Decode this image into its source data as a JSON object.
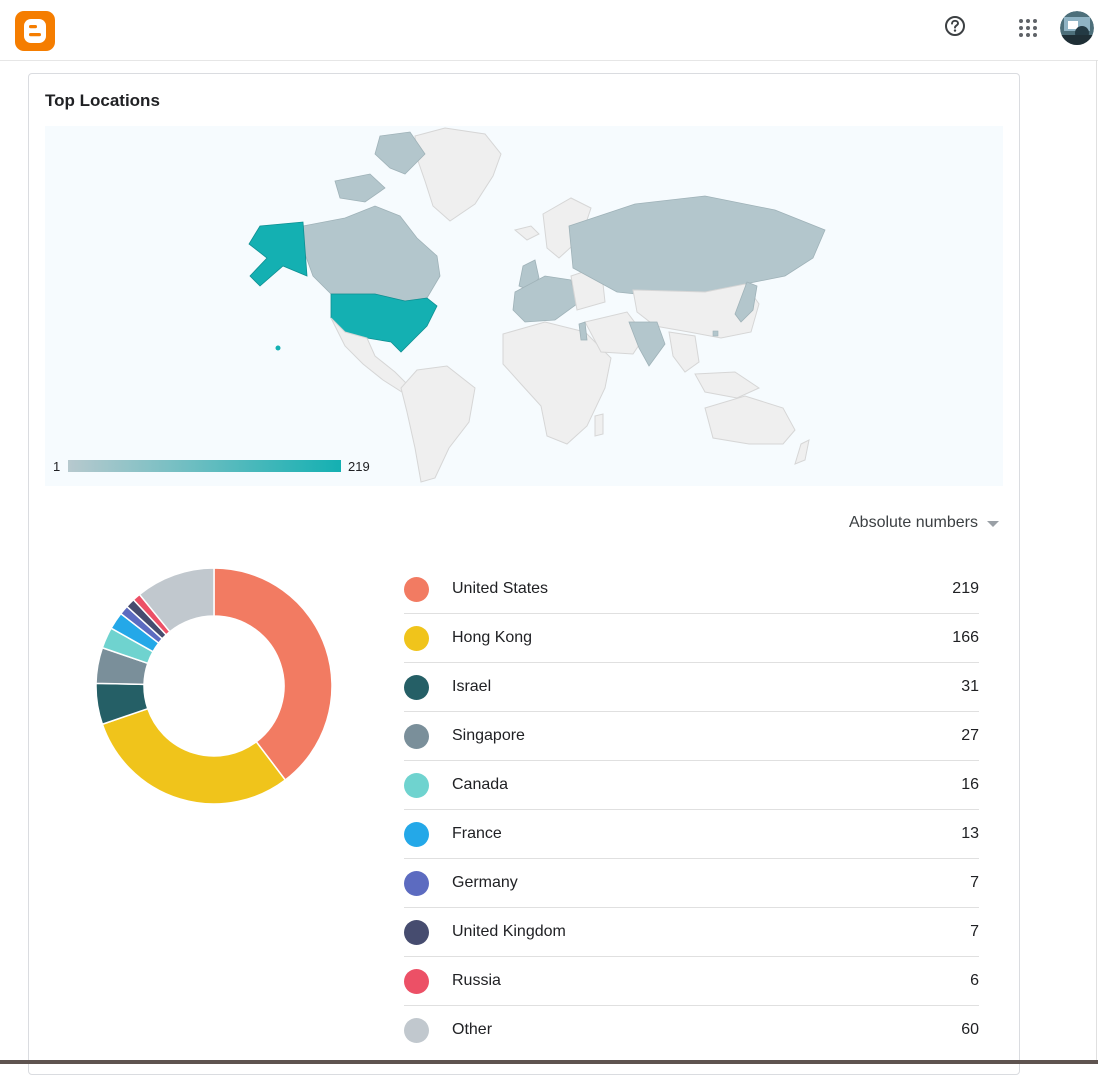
{
  "card": {
    "title": "Top Locations",
    "dropdown_label": "Absolute numbers"
  },
  "map": {
    "scale_min": "1",
    "scale_max": "219",
    "colors": {
      "low": "#b7c9ce",
      "high": "#14b0b2",
      "no_data": "#f0f0f0",
      "background": "#f6fbfe"
    }
  },
  "icons": {
    "logo": "blogger-logo-icon",
    "help": "help-circle-icon",
    "apps": "apps-grid-icon",
    "avatar": "user-avatar"
  },
  "chart_data": {
    "type": "pie",
    "categories": [
      "United States",
      "Hong Kong",
      "Israel",
      "Singapore",
      "Canada",
      "France",
      "Germany",
      "United Kingdom",
      "Russia",
      "Other"
    ],
    "values": [
      219,
      166,
      31,
      27,
      16,
      13,
      7,
      7,
      6,
      60
    ],
    "colors": [
      "#f27b62",
      "#f0c41b",
      "#255f66",
      "#7a8f9a",
      "#6fd3cf",
      "#24a8e8",
      "#5c6bc0",
      "#464c6f",
      "#ec5066",
      "#c1c8ce"
    ],
    "labels": [
      "219",
      "166",
      "31",
      "27",
      "16",
      "13",
      "7",
      "7",
      "6",
      "60"
    ],
    "donut": true,
    "legend_position": "right"
  }
}
